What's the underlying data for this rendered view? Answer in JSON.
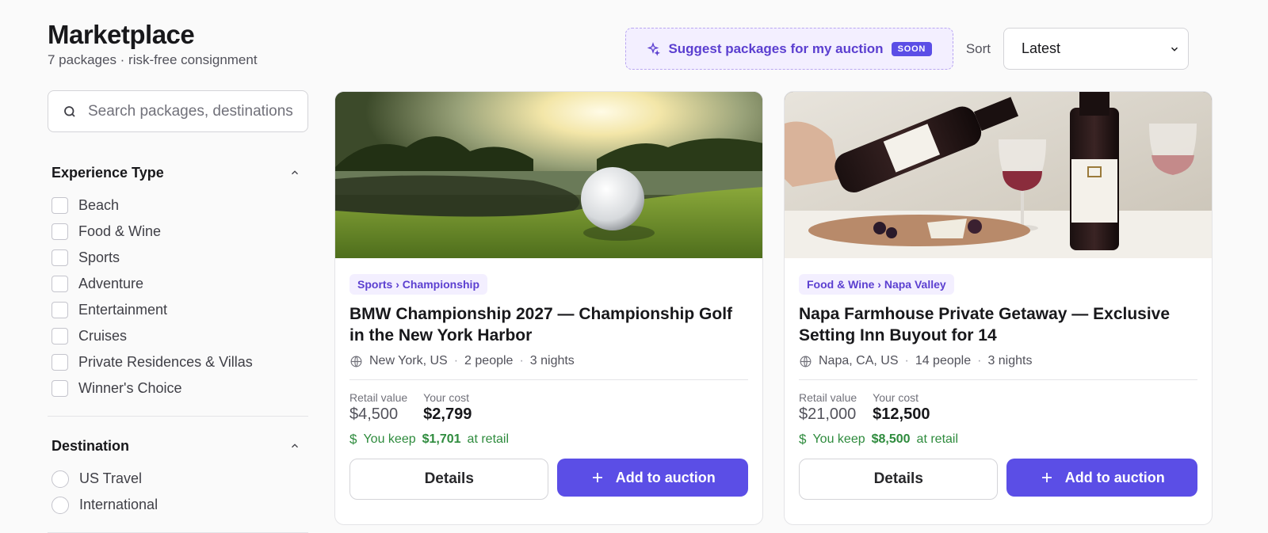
{
  "header": {
    "title": "Marketplace",
    "subtitle": "7 packages · risk-free consignment"
  },
  "suggest": {
    "label": "Suggest packages for my auction",
    "badge": "SOON",
    "icon": "sparkle-icon"
  },
  "sort": {
    "label": "Sort",
    "value": "Latest"
  },
  "search": {
    "placeholder": "Search packages, destinations"
  },
  "filters": {
    "experience": {
      "title": "Experience Type",
      "options": [
        "Beach",
        "Food & Wine",
        "Sports",
        "Adventure",
        "Entertainment",
        "Cruises",
        "Private Residences & Villas",
        "Winner's Choice"
      ]
    },
    "destination": {
      "title": "Destination",
      "options": [
        "US Travel",
        "International"
      ]
    }
  },
  "cards": [
    {
      "category": "Sports › Championship",
      "title": "BMW Championship 2027 — Championship Golf in the New York Harbor",
      "location": "New York, US",
      "people": "2 people",
      "nights": "3 nights",
      "retail_label": "Retail value",
      "retail": "$4,500",
      "cost_label": "Your cost",
      "cost": "$2,799",
      "keep_prefix": "You keep",
      "keep_amount": "$1,701",
      "keep_suffix": "at retail",
      "details_label": "Details",
      "add_label": "Add to auction"
    },
    {
      "category": "Food & Wine › Napa Valley",
      "title": "Napa Farmhouse Private Getaway — Exclusive Setting Inn Buyout for 14",
      "location": "Napa, CA, US",
      "people": "14 people",
      "nights": "3 nights",
      "retail_label": "Retail value",
      "retail": "$21,000",
      "cost_label": "Your cost",
      "cost": "$12,500",
      "keep_prefix": "You keep",
      "keep_amount": "$8,500",
      "keep_suffix": "at retail",
      "details_label": "Details",
      "add_label": "Add to auction"
    }
  ],
  "colors": {
    "accent": "#5b4ee6",
    "keep_green": "#2e8b3d"
  }
}
